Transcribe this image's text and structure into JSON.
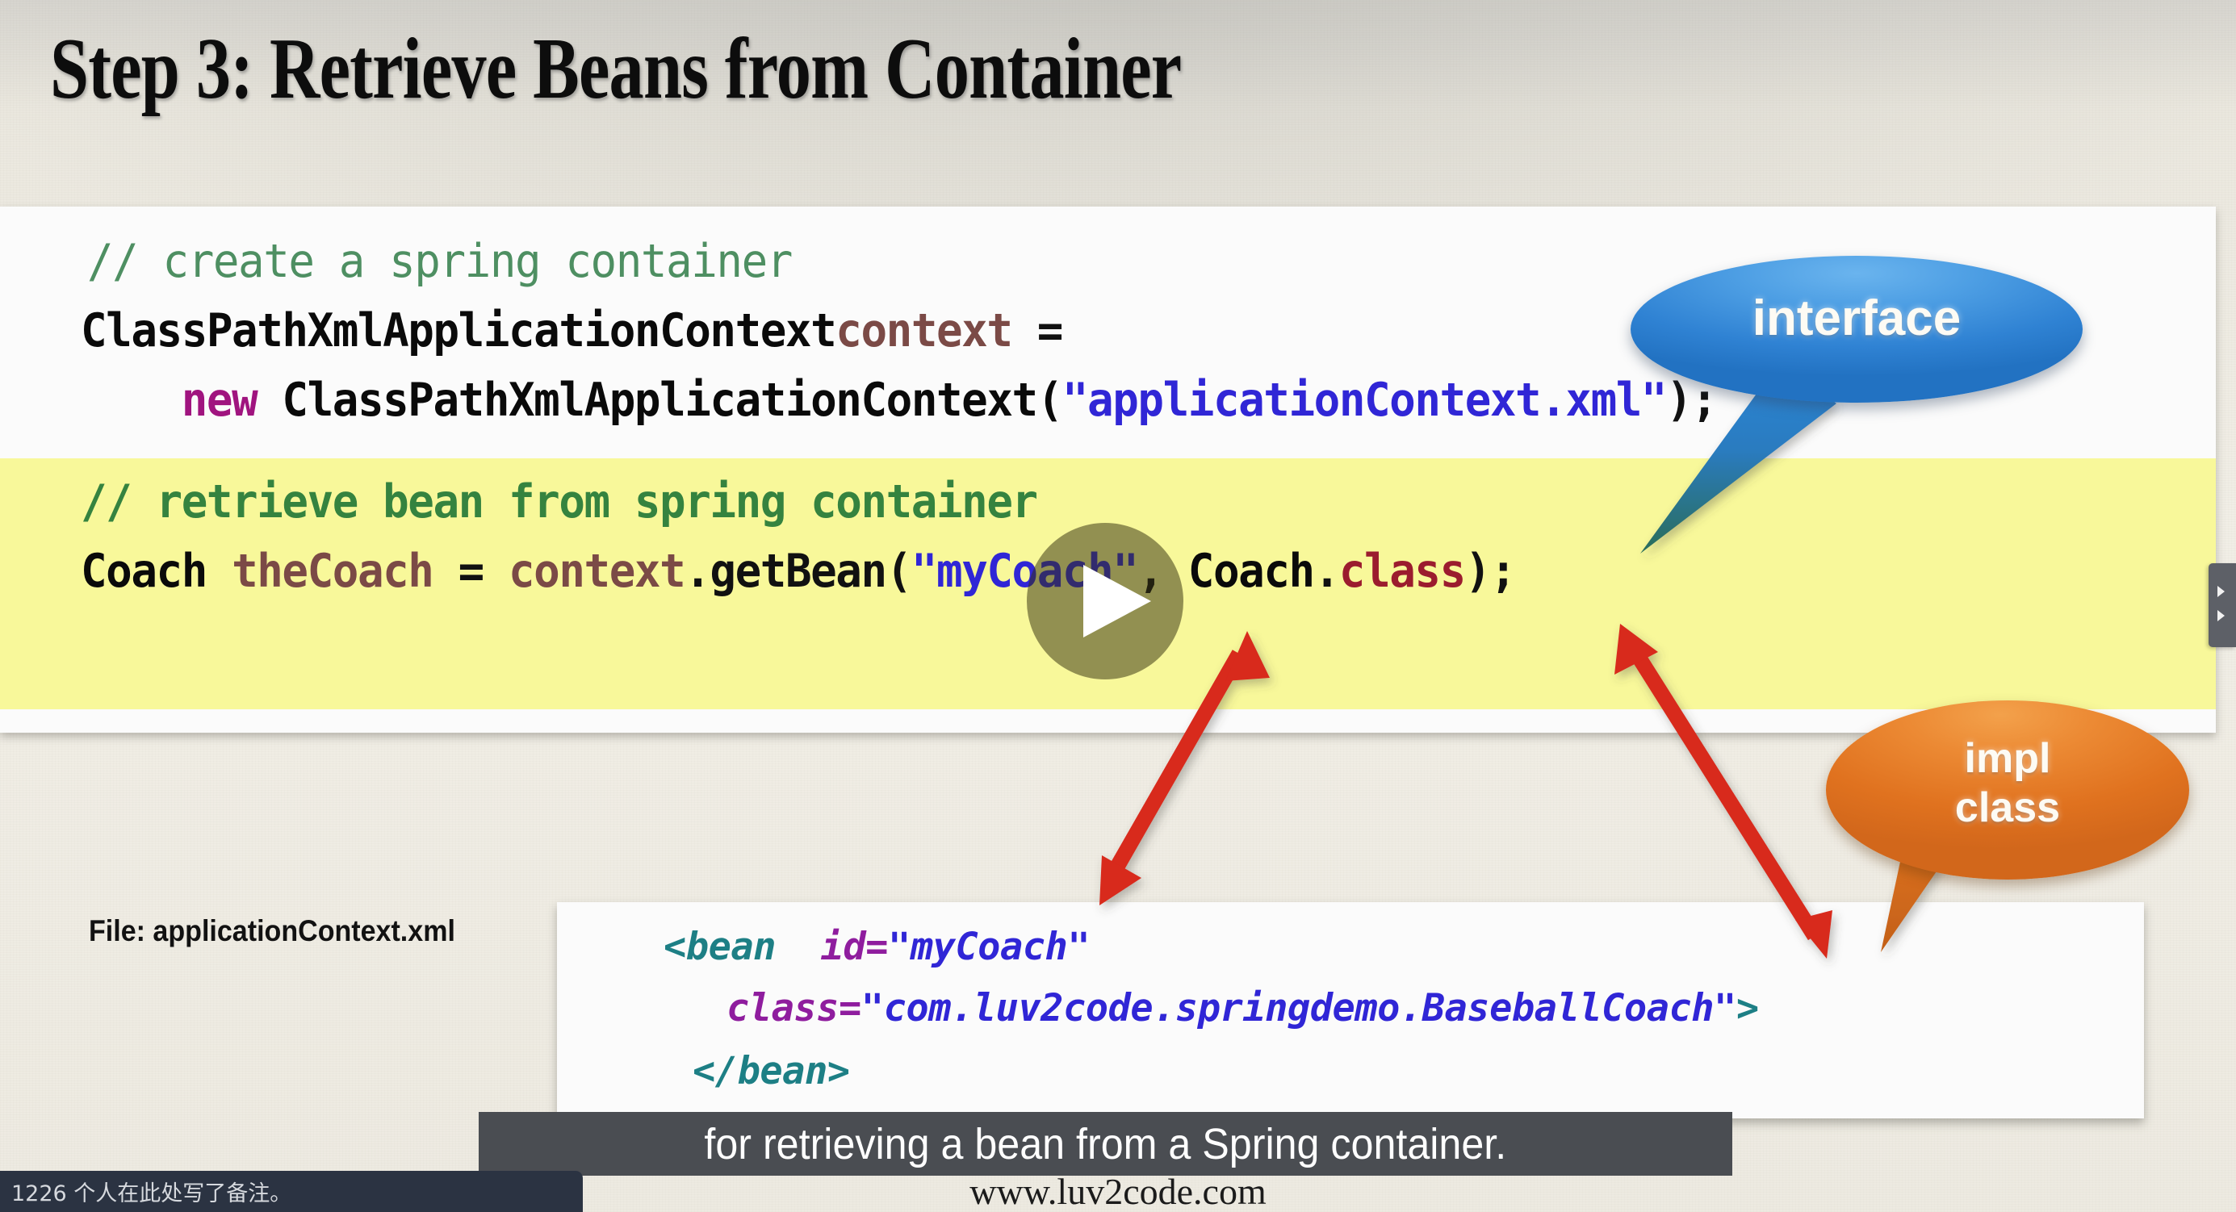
{
  "slide": {
    "title": "Step 3: Retrieve Beans from Container",
    "footer_url": "www.luv2code.com",
    "file_label": "File: applicationContext.xml"
  },
  "java_code": {
    "line1_comment": "// create a spring container",
    "line2_type": "ClassPathXmlApplicationContext",
    "line2_var": "context",
    "line2_op": " =",
    "line3_kw": "new",
    "line3_call": " ClassPathXmlApplicationContext(",
    "line3_str": "\"applicationContext.xml\"",
    "line3_end": ");",
    "line4_comment": "// retrieve bean from spring container",
    "line5_type": "Coach",
    "line5_var": " theCoach",
    "line5_op": " = ",
    "line5_ctx": "context",
    "line5_dot": ".",
    "line5_method": "getBean(",
    "line5_str": "\"myCoach\"",
    "line5_sep": ", ",
    "line5_class": "Coach",
    "line5_dot2": ".",
    "line5_field": "class",
    "line5_end": ");"
  },
  "xml_code": {
    "l1_tag": "<bean",
    "l1_attr": "  id=",
    "l1_val": "\"myCoach\"",
    "l2_attr": "class=",
    "l2_val": "\"com.luv2code.springdemo.BaseballCoach\"",
    "l2_close": ">",
    "l3_tag": "</bean>"
  },
  "callouts": {
    "interface": "interface",
    "impl_line1": "impl",
    "impl_line2": "class"
  },
  "player": {
    "play_label": "play-button",
    "right_tab_label": "expand-panel"
  },
  "caption": {
    "text": "for retrieving a bean from a Spring container."
  },
  "note": {
    "text": "1226 个人在此处写了备注。"
  },
  "colors": {
    "paper": "#efece3",
    "highlight_yellow": "#f8f89a",
    "comment_green": "#4e8f62",
    "keyword_purple": "#a0147f",
    "string_blue": "#3026d6",
    "variable_brown": "#7b4a46",
    "field_red": "#9b1c2e",
    "xml_tag_teal": "#1d7f85",
    "xml_attr_purple": "#8f1d9e",
    "callout_blue": "#2f82d3",
    "callout_orange": "#e0721f",
    "arrow_red": "#d8291c",
    "caption_bg": "#4a4d52",
    "note_bg": "#2b3342"
  }
}
